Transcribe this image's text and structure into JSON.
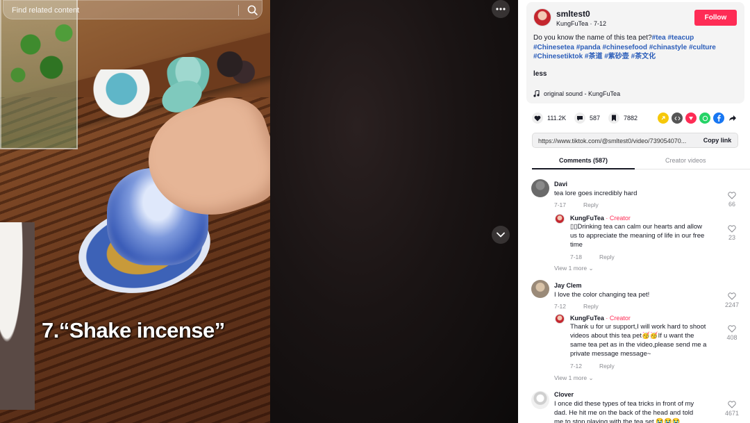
{
  "search": {
    "placeholder": "Find related content"
  },
  "video": {
    "caption": "7.“Shake incense”"
  },
  "post": {
    "author": "smltest0",
    "meta": "KungFuTea · 7-12",
    "follow_label": "Follow",
    "desc_intro": "Do you know the name of this tea pet?",
    "tags_line1": "#tea #teacup",
    "tags_line2": "#Chinesetea #panda #chinesefood #chinastyle #culture",
    "tags_line3": "#Chinesetiktok #茶道 #紫砂壶 #茶文化",
    "less_label": "less",
    "sound": "original sound - KungFuTea"
  },
  "stats": {
    "likes": "111.2K",
    "comments": "587",
    "saves": "7882"
  },
  "share_icons": [
    {
      "name": "embed-icon",
      "color": "#f6c80a"
    },
    {
      "name": "code-icon",
      "color": "#555555"
    },
    {
      "name": "send-icon",
      "color": "#fe2c55"
    },
    {
      "name": "whatsapp-icon",
      "color": "#25d366"
    },
    {
      "name": "facebook-icon",
      "color": "#1877f2"
    },
    {
      "name": "share-arrow-icon",
      "color": "#161823"
    }
  ],
  "link": {
    "url": "https://www.tiktok.com/@smltest0/video/739054070...",
    "copy_label": "Copy link"
  },
  "tabs": {
    "comments": "Comments (587)",
    "creator": "Creator videos"
  },
  "comments": [
    {
      "user": "Davi",
      "text": "tea lore goes incredibly hard",
      "date": "7-17",
      "reply_label": "Reply",
      "likes": "66",
      "reply": {
        "user": "KungFuTea",
        "badge": "· Creator",
        "text_lines": [
          "▯▯Drinking tea can calm our hearts and allow",
          "us to appreciate the meaning of life in our free",
          "time"
        ],
        "date": "7-18",
        "reply_label": "Reply",
        "likes": "23"
      },
      "view_more": "View 1 more"
    },
    {
      "user": "Jay Clem",
      "text": "I love the color changing tea pet!",
      "date": "7-12",
      "reply_label": "Reply",
      "likes": "2247",
      "reply": {
        "user": "KungFuTea",
        "badge": "· Creator",
        "text_lines": [
          "Thank u for ur support,I will work hard to shoot",
          "videos about this tea pet🥳🥳If u want the",
          "same tea pet as in the video,please send me a",
          "private message message~"
        ],
        "date": "7-12",
        "reply_label": "Reply",
        "likes": "408"
      },
      "view_more": "View 1 more"
    },
    {
      "user": "Clover",
      "text_lines": [
        "I once did these types of tea tricks in front of my",
        "dad. He hit me on the back of the head and told",
        "me to stop playing with the tea set 😭😭😭"
      ],
      "likes": "4671"
    }
  ]
}
